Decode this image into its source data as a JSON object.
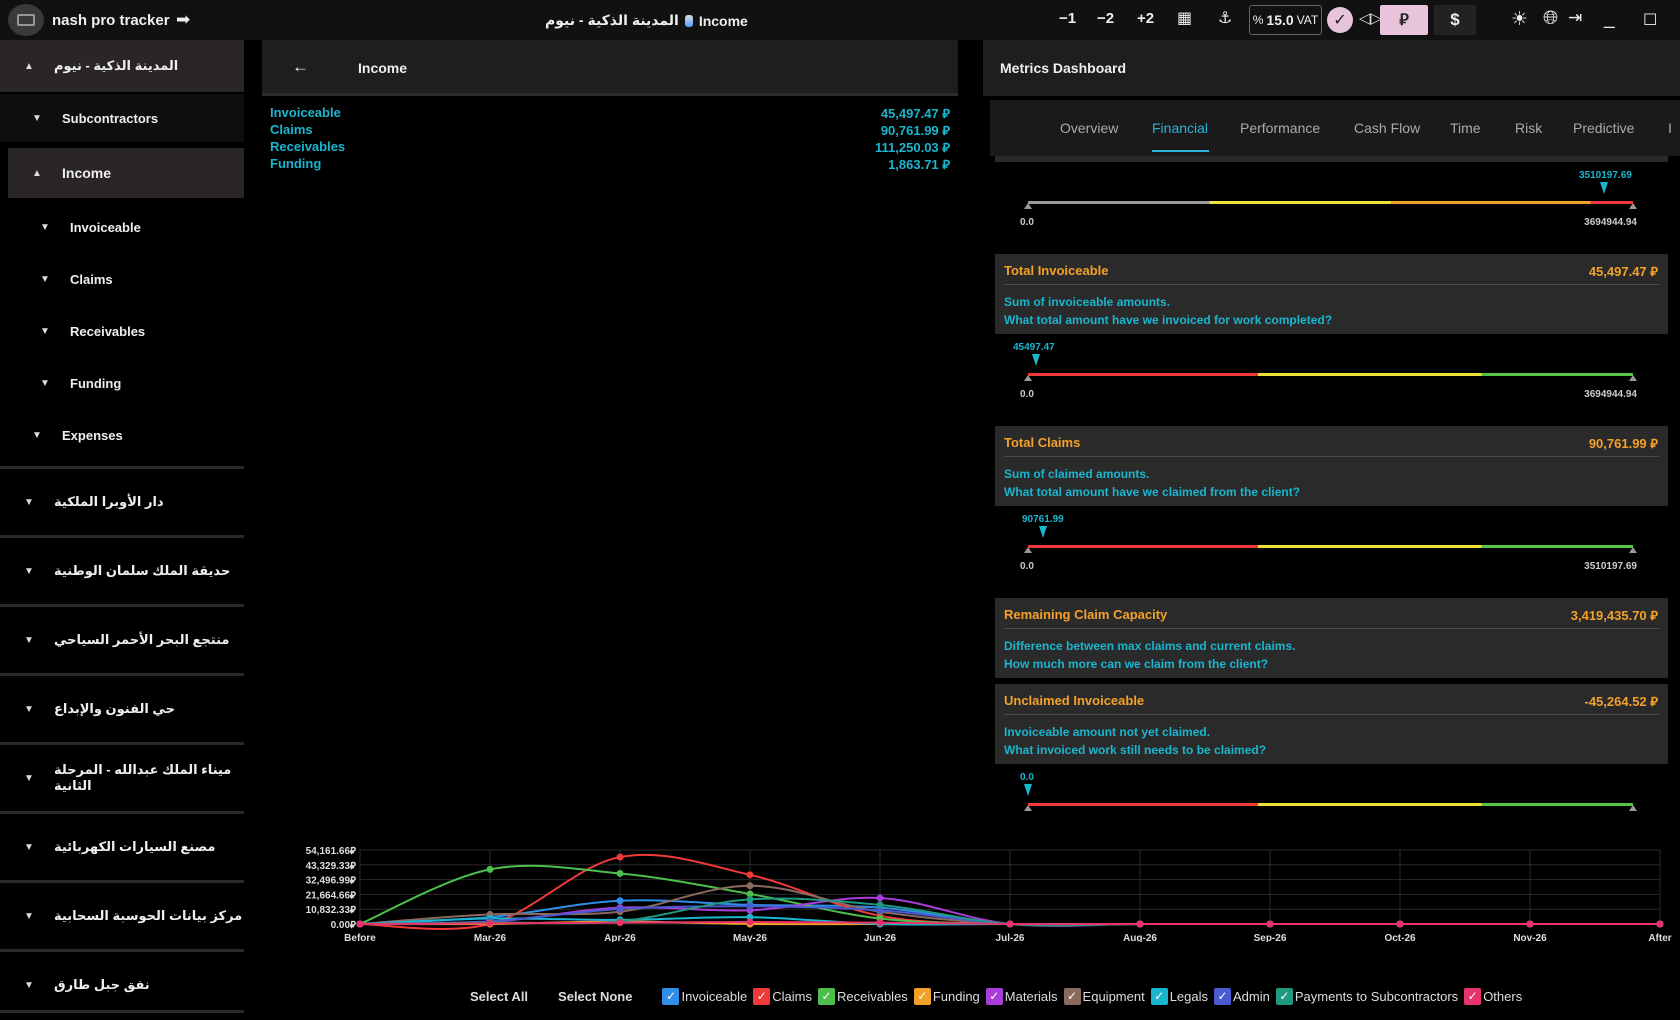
{
  "app": {
    "name": "nash pro tracker"
  },
  "breadcrumb": {
    "project": "المدينة الذكية - نيوم",
    "page": "Income"
  },
  "toolbar": {
    "minus1": "−1",
    "minus2": "−2",
    "plus2": "+2",
    "vat_prefix": "%",
    "vat_value": "15.0",
    "vat_label": "VAT",
    "currency_sar": "⃁",
    "currency_usd": "$"
  },
  "sidebar": {
    "active_project": "المدينة الذكية - نيوم",
    "items": [
      {
        "label": "Subcontractors"
      },
      {
        "label": "Income"
      },
      {
        "label": "Invoiceable"
      },
      {
        "label": "Claims"
      },
      {
        "label": "Receivables"
      },
      {
        "label": "Funding"
      },
      {
        "label": "Expenses"
      }
    ],
    "projects": [
      "دار الأوبرا الملكية",
      "حديقة الملك سلمان الوطنية",
      "منتجع البحر الأحمر السياحي",
      "حي الفنون والإبداع",
      "ميناء الملك عبدالله - المرحلة الثانية",
      "مصنع السيارات الكهربائية",
      "مركز بيانات الحوسبة السحابية",
      "نفق جبل طارق"
    ]
  },
  "income_panel": {
    "title": "Income",
    "rows": [
      {
        "label": "Invoiceable",
        "value": "45,497.47 ⃁"
      },
      {
        "label": "Claims",
        "value": "90,761.99 ⃁"
      },
      {
        "label": "Receivables",
        "value": "111,250.03 ⃁"
      },
      {
        "label": "Funding",
        "value": "1,863.71 ⃁"
      }
    ]
  },
  "metrics": {
    "title": "Metrics Dashboard",
    "tabs": [
      "Overview",
      "Financial",
      "Performance",
      "Cash Flow",
      "Time",
      "Risk",
      "Predictive",
      "I"
    ],
    "active_tab": "Financial",
    "top_gauge": {
      "min": "0.0",
      "max": "3694944.94",
      "marker": "3510197.69",
      "fraction": 0.95
    },
    "cards": [
      {
        "title": "Total Invoiceable",
        "value": "45,497.47 ⃁",
        "line1": "Sum of invoiceable amounts.",
        "line2": "What total amount have we invoiced for work completed?",
        "gauge": {
          "min": "0.0",
          "max": "3694944.94",
          "marker": "45497.47",
          "fraction": 0.0123
        }
      },
      {
        "title": "Total Claims",
        "value": "90,761.99 ⃁",
        "line1": "Sum of claimed amounts.",
        "line2": "What total amount have we claimed from the client?",
        "gauge": {
          "min": "0.0",
          "max": "3510197.69",
          "marker": "90761.99",
          "fraction": 0.0259
        }
      },
      {
        "title": "Remaining Claim Capacity",
        "value": "3,419,435.70 ⃁",
        "line1": "Difference between max claims and current claims.",
        "line2": "How much more can we claim from the client?"
      },
      {
        "title": "Unclaimed Invoiceable",
        "value": "-45,264.52 ⃁",
        "line1": "Invoiceable amount not yet claimed.",
        "line2": "What invoiced work still needs to be claimed?",
        "gauge": {
          "min": "",
          "max": "",
          "marker": "0.0",
          "fraction": 0
        }
      }
    ],
    "colors": {
      "gray": "#9a9a9a",
      "yellow": "#f0e03a",
      "orange": "#f4a12a",
      "red": "#f03a3a",
      "green": "#55c447"
    }
  },
  "chart_data": {
    "type": "line",
    "x": [
      "Before",
      "Mar-26",
      "Apr-26",
      "May-26",
      "Jun-26",
      "Jul-26",
      "Aug-26",
      "Sep-26",
      "Oct-26",
      "Nov-26",
      "After"
    ],
    "y_ticks": [
      "54,161.66⃁",
      "43,329.33⃁",
      "32,496.99⃁",
      "21,664.66⃁",
      "10,832.33⃁",
      "0.00⃁"
    ],
    "ylim": [
      0,
      54161.66
    ],
    "series": [
      {
        "name": "Invoiceable",
        "color": "#2f8fe8",
        "values": [
          0,
          5000,
          17000,
          14000,
          12000,
          0,
          0,
          0,
          0,
          0,
          0
        ]
      },
      {
        "name": "Claims",
        "color": "#f03a3a",
        "values": [
          0,
          0,
          49000,
          36000,
          6000,
          0,
          0,
          0,
          0,
          0,
          0
        ]
      },
      {
        "name": "Receivables",
        "color": "#4cbf4c",
        "values": [
          0,
          40000,
          37000,
          22000,
          4000,
          0,
          0,
          0,
          0,
          0,
          0
        ]
      },
      {
        "name": "Funding",
        "color": "#f4a12a",
        "values": [
          0,
          0,
          1800,
          0,
          0,
          0,
          0,
          0,
          0,
          0,
          0
        ]
      },
      {
        "name": "Materials",
        "color": "#a83dd8",
        "values": [
          0,
          1500,
          12000,
          10000,
          19000,
          0,
          0,
          0,
          0,
          0,
          0
        ]
      },
      {
        "name": "Equipment",
        "color": "#8a6a5e",
        "values": [
          0,
          7000,
          9000,
          28000,
          9000,
          0,
          0,
          0,
          0,
          0,
          0
        ]
      },
      {
        "name": "Legals",
        "color": "#1ab5cf",
        "values": [
          0,
          4000,
          3000,
          5000,
          0,
          0,
          0,
          0,
          0,
          0,
          0
        ]
      },
      {
        "name": "Admin",
        "color": "#4a5ad0",
        "values": [
          0,
          2000,
          11000,
          13000,
          10000,
          0,
          0,
          0,
          0,
          0,
          0
        ]
      },
      {
        "name": "Payments to Subcontractors",
        "color": "#1f9a80",
        "values": [
          0,
          1000,
          2000,
          18000,
          14000,
          0,
          0,
          0,
          0,
          0,
          0
        ]
      },
      {
        "name": "Others",
        "color": "#e8336a",
        "values": [
          0,
          500,
          1000,
          1500,
          1000,
          0,
          0,
          0,
          0,
          0,
          0
        ]
      }
    ]
  },
  "legend": {
    "select_all": "Select All",
    "select_none": "Select None"
  }
}
